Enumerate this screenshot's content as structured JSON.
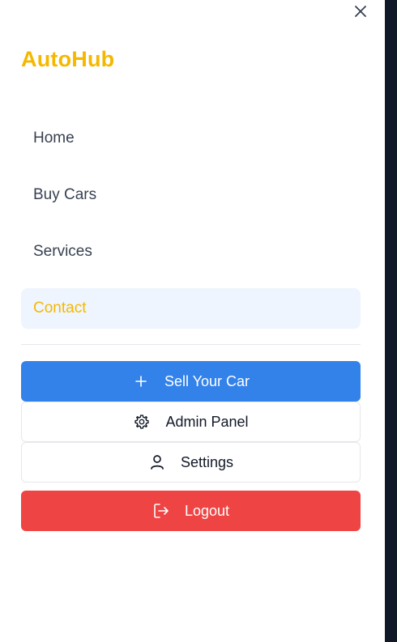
{
  "brand": "AutoHub",
  "nav": {
    "items": [
      {
        "label": "Home"
      },
      {
        "label": "Buy Cars"
      },
      {
        "label": "Services"
      },
      {
        "label": "Contact"
      }
    ]
  },
  "actions": {
    "sell_label": "Sell Your Car",
    "admin_label": "Admin Panel",
    "settings_label": "Settings",
    "logout_label": "Logout"
  },
  "colors": {
    "brand": "#f5b800",
    "primary": "#3282ea",
    "danger": "#ef4444",
    "active_bg": "#eef5fe"
  },
  "icons": {
    "close": "close-icon",
    "sell": "plus-icon",
    "admin": "gear-icon",
    "settings": "user-icon",
    "logout": "logout-icon"
  }
}
